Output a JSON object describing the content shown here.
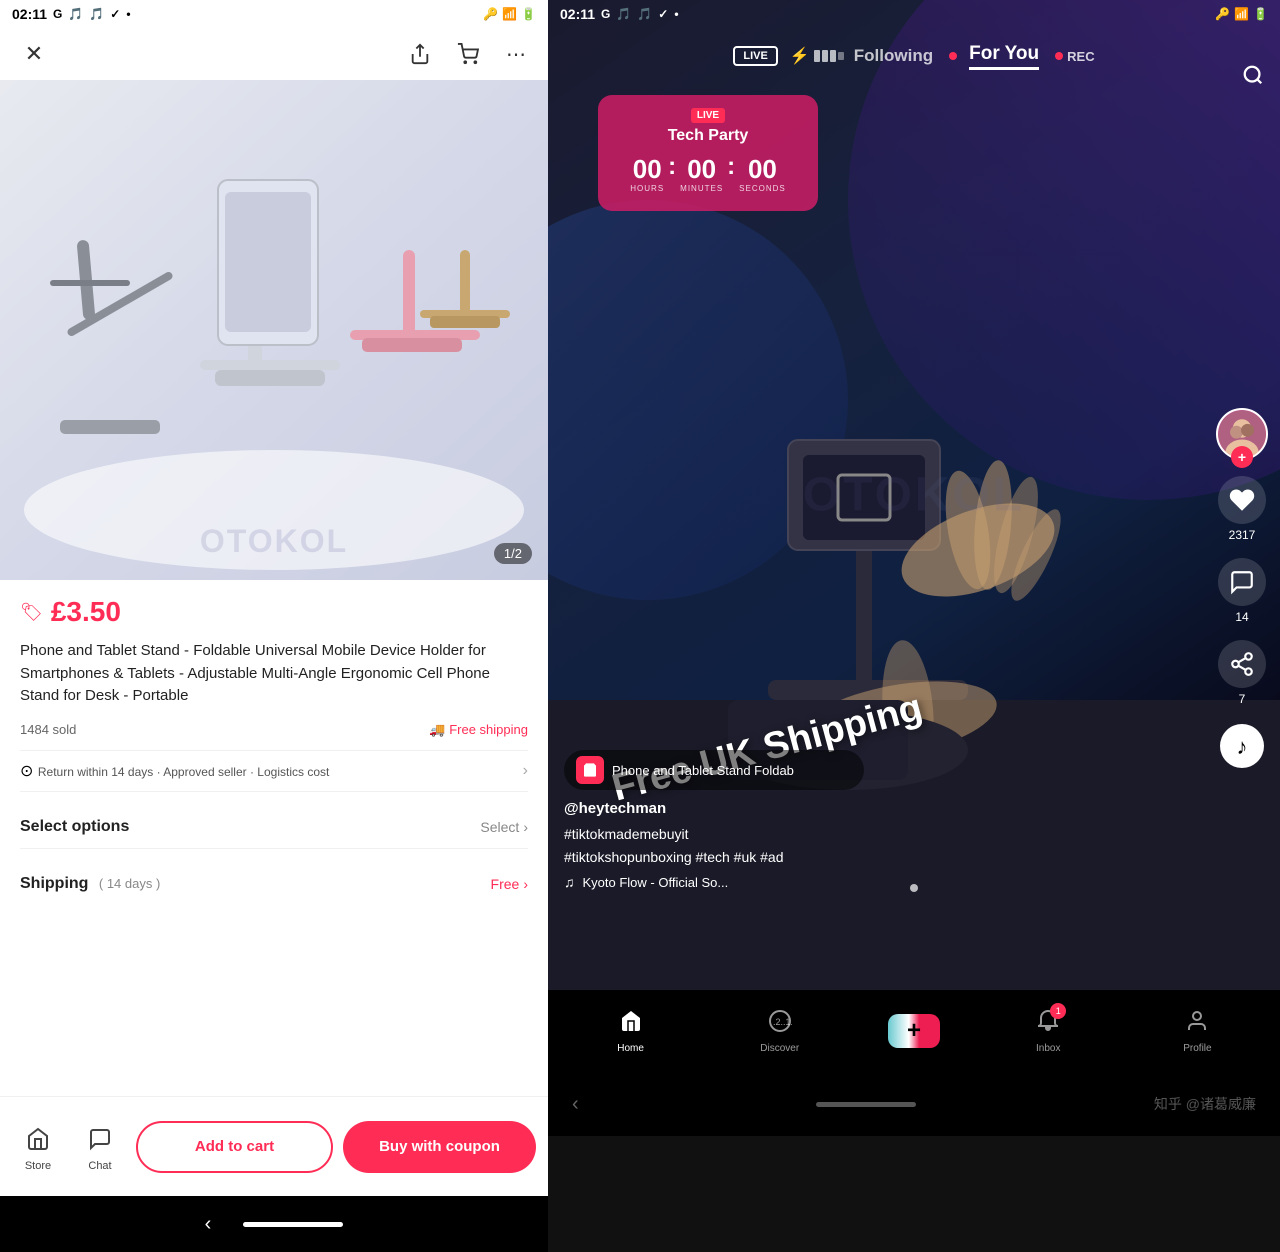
{
  "left": {
    "statusBar": {
      "time": "02:11",
      "icons": [
        "G",
        "🎵",
        "🎵",
        "✓",
        "•"
      ]
    },
    "nav": {
      "closeLabel": "✕",
      "shareLabel": "↑",
      "cartLabel": "🛒",
      "moreLabel": "⋯"
    },
    "product": {
      "imageCounter": "1/2",
      "watermark": "OTOKOL",
      "price": "£3.50",
      "priceIcon": "🏷",
      "title": "Phone and Tablet Stand - Foldable Universal Mobile Device Holder for Smartphones & Tablets - Adjustable Multi-Angle Ergonomic Cell Phone Stand for Desk - Portable",
      "sold": "1484 sold",
      "freeShipping": "Free shipping",
      "freeShippingIcon": "🚚",
      "returnText": "Return within 14 days · Approved seller · Logistics cost",
      "selectOptionsLabel": "Select options",
      "selectBtnLabel": "Select",
      "shippingLabel": "Shipping",
      "shippingDays": "( 14 days )",
      "shippingFree": "Free",
      "shippingChevron": "›"
    },
    "bottomBar": {
      "storeLabel": "Store",
      "chatLabel": "Chat",
      "addToCartLabel": "Add to cart",
      "buyWithCouponLabel": "Buy with coupon"
    }
  },
  "right": {
    "statusBar": {
      "time": "02:11",
      "icons": [
        "G",
        "🎵",
        "🎵",
        "✓",
        "•",
        "🔑",
        "📶",
        "🔋"
      ]
    },
    "topNav": {
      "liveBadge": "LIVE",
      "followingLabel": "Following",
      "forYouLabel": "For You",
      "recLabel": "REC"
    },
    "liveCard": {
      "liveMini": "LIVE",
      "eventName": "Tech Party",
      "hours": "00",
      "minutes": "00",
      "seconds": "00",
      "hoursLabel": "HOURS",
      "minutesLabel": "MINUTES",
      "secondsLabel": "SECONDS"
    },
    "watermark": "OTOKOL",
    "freeUKShipping": "Free UK Shipping",
    "productPill": {
      "icon": "🛍",
      "text": "Phone and Tablet Stand  Foldab"
    },
    "user": {
      "username": "@heytechman",
      "hashtags": "#tiktokmademebuyit\n#tiktokshopunboxing #tech #uk #ad"
    },
    "music": {
      "note": "♫",
      "title": "Kyoto Flow - Official So..."
    },
    "actions": {
      "likeCount": "2317",
      "commentCount": "14",
      "shareCount": "7"
    },
    "bottomNav": {
      "homeLabel": "Home",
      "discoverLabel": "Discover",
      "inboxLabel": "Inbox",
      "inboxBadge": "1",
      "profileLabel": "Profile"
    },
    "zhihuWatermark": "知乎 @诸葛威廉"
  }
}
